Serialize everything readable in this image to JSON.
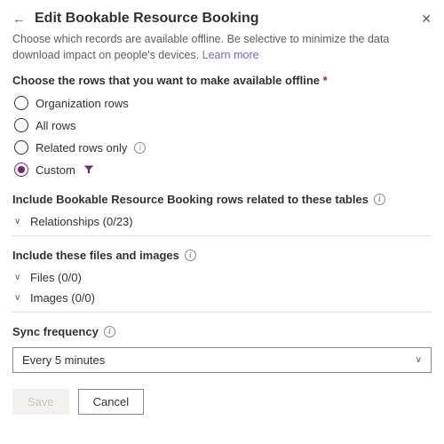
{
  "header": {
    "title": "Edit Bookable Resource Booking",
    "description_pre": "Choose which records are available offline. Be selective to minimize the data download impact on people's devices. ",
    "learn_more": "Learn more"
  },
  "rows_section": {
    "label": "Choose the rows that you want to make available offline",
    "required_mark": "*",
    "options": {
      "organization": "Organization rows",
      "all": "All rows",
      "related": "Related rows only",
      "custom": "Custom"
    }
  },
  "related_tables": {
    "heading": "Include Bookable Resource Booking rows related to these tables",
    "relationships_label": "Relationships (0/23)"
  },
  "files_images": {
    "heading": "Include these files and images",
    "files_label": "Files (0/0)",
    "images_label": "Images (0/0)"
  },
  "sync": {
    "label": "Sync frequency",
    "selected": "Every 5 minutes"
  },
  "buttons": {
    "save": "Save",
    "cancel": "Cancel"
  }
}
